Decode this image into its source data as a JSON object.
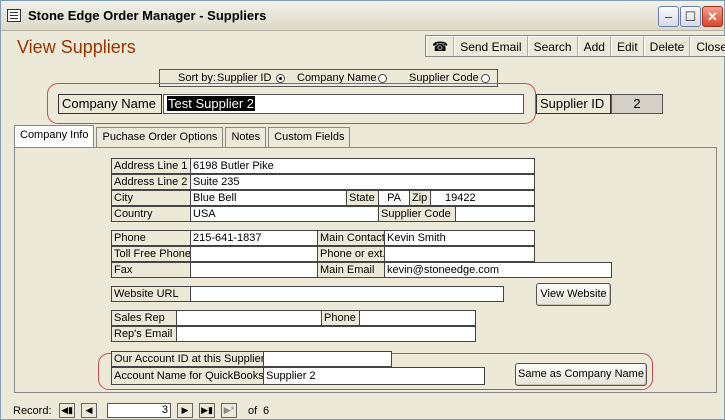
{
  "window": {
    "title": "Stone Edge Order Manager - Suppliers",
    "minimize": "‒",
    "maximize": "☐",
    "close": "✕"
  },
  "header": {
    "title": "View Suppliers"
  },
  "toolbar": {
    "phone_icon": "☎",
    "send_email": "Send Email",
    "search": "Search",
    "add": "Add",
    "edit": "Edit",
    "delete": "Delete",
    "close": "Close"
  },
  "sort": {
    "label": "Sort by:",
    "options": [
      "Supplier ID",
      "Company Name",
      "Supplier Code"
    ],
    "selected": "Supplier ID"
  },
  "company": {
    "label": "Company Name",
    "value": "Test Supplier 2"
  },
  "supplier_id": {
    "label": "Supplier ID",
    "value": "2"
  },
  "tabs": [
    "Company Info",
    "Puchase Order Options",
    "Notes",
    "Custom Fields"
  ],
  "info": {
    "address1_label": "Address Line 1",
    "address1": "6198 Butler Pike",
    "address2_label": "Address Line 2",
    "address2": "Suite 235",
    "city_label": "City",
    "city": "Blue Bell",
    "state_label": "State",
    "state": "PA",
    "zip_label": "Zip",
    "zip": "19422",
    "country_label": "Country",
    "country": "USA",
    "supplier_code_label": "Supplier Code",
    "supplier_code": "",
    "phone_label": "Phone",
    "phone": "215-641-1837",
    "main_contact_label": "Main Contact",
    "main_contact": "Kevin Smith",
    "toll_free_label": "Toll Free Phone",
    "toll_free": "",
    "phone_ext_label": "Phone or ext.",
    "phone_ext": "",
    "fax_label": "Fax",
    "fax": "",
    "main_email_label": "Main Email",
    "main_email": "kevin@stoneedge.com",
    "website_label": "Website URL",
    "website": "",
    "view_website": "View Website",
    "sales_rep_label": "Sales Rep",
    "sales_rep": "",
    "sales_rep_phone_label": "Phone",
    "sales_rep_phone": "",
    "rep_email_label": "Rep's Email",
    "rep_email": "",
    "account_id_label": "Our Account ID at this Supplier",
    "account_id": "",
    "account_qb_label": "Account Name for QuickBooks",
    "account_qb": "Supplier 2",
    "same_as_company": "Same as Company Name"
  },
  "record": {
    "label": "Record:",
    "current": "3",
    "of_label": "of",
    "total": "6"
  }
}
